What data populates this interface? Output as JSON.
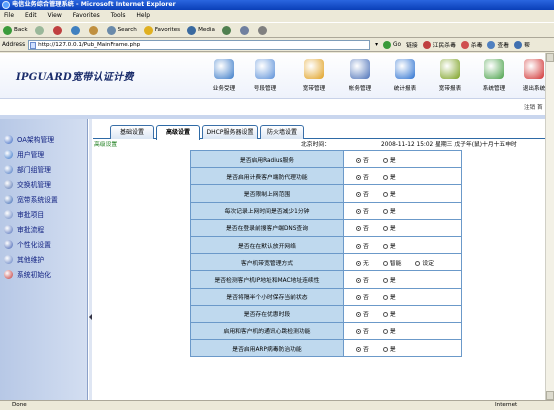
{
  "window": {
    "title": "电信业务综合管理系统 - Microsoft Internet Explorer"
  },
  "menu": [
    "File",
    "Edit",
    "View",
    "Favorites",
    "Tools",
    "Help"
  ],
  "toolbar": {
    "back": "Back",
    "search": "Search",
    "favorites": "Favorites",
    "media": "Media"
  },
  "address": {
    "label": "Address",
    "url": "http://127.0.0.1/Pub_MainFrame.php",
    "go": "Go",
    "links": "链接",
    "extra1": "江民杀毒",
    "extra2": "杀毒",
    "extra3": "查看",
    "extra4": "帮"
  },
  "app": {
    "brand": "IPGUARD宽带认证计费",
    "logout": "注销",
    "logout_extra": "首"
  },
  "nav": [
    {
      "label": "业务受理",
      "color": "#3a7ac8"
    },
    {
      "label": "号段管理",
      "color": "#5a8fd8"
    },
    {
      "label": "宽带管理",
      "color": "#e0a020"
    },
    {
      "label": "帐务管理",
      "color": "#4a70b8"
    },
    {
      "label": "统计报表",
      "color": "#2a70d0"
    },
    {
      "label": "宽带报表",
      "color": "#7aa020"
    },
    {
      "label": "系统管理",
      "color": "#48a048"
    },
    {
      "label": "退出系统",
      "color": "#d03030"
    }
  ],
  "sidebar": {
    "items": [
      {
        "label": "OA架构管理",
        "color": "#3060c0"
      },
      {
        "label": "用户管理",
        "color": "#3070c8"
      },
      {
        "label": "部门组管理",
        "color": "#4070c0"
      },
      {
        "label": "交换机管理",
        "color": "#5070b0"
      },
      {
        "label": "宽带系统设置",
        "color": "#3060b0"
      },
      {
        "label": "审批项目",
        "color": "#6080c0"
      },
      {
        "label": "审批流程",
        "color": "#4a6ab8"
      },
      {
        "label": "个性化设置",
        "color": "#3a5ab0"
      },
      {
        "label": "其他维护",
        "color": "#5a7ac0"
      },
      {
        "label": "系统初始化",
        "color": "#c03030"
      }
    ]
  },
  "tabs": [
    {
      "label": "基础设置"
    },
    {
      "label": "高级设置",
      "active": true
    },
    {
      "label": "DHCP服务器设置"
    },
    {
      "label": "防火墙设置"
    }
  ],
  "panel": {
    "section": "高级设置",
    "time_label": "北京时间：",
    "time_value": "2008-11-12 15:02 星期三 戊子年(鼠)十月十五申时"
  },
  "settings": [
    {
      "question": "是否启用Radius服务",
      "options": [
        "否",
        "是"
      ],
      "selected": 0
    },
    {
      "question": "是否启用计费客户端防代理功能",
      "options": [
        "否",
        "是"
      ],
      "selected": 0
    },
    {
      "question": "是否限制上网范围",
      "options": [
        "否",
        "是"
      ],
      "selected": 0
    },
    {
      "question": "每次记录上网时间是否减少1分钟",
      "options": [
        "否",
        "是"
      ],
      "selected": 0
    },
    {
      "question": "是否在登录前搜客户端DNS查询",
      "options": [
        "否",
        "是"
      ],
      "selected": 0
    },
    {
      "question": "是否在在默认放开网络",
      "options": [
        "否",
        "是"
      ],
      "selected": 0
    },
    {
      "question": "客户机带宽管理方式",
      "options": [
        "无",
        "智能",
        "设定"
      ],
      "selected": 0
    },
    {
      "question": "是否检测客户机IP地址和MAC地址连续性",
      "options": [
        "否",
        "是"
      ],
      "selected": 0
    },
    {
      "question": "是否将隔半个小时保存当前状态",
      "options": [
        "否",
        "是"
      ],
      "selected": 0
    },
    {
      "question": "是否存在优惠时段",
      "options": [
        "否",
        "是"
      ],
      "selected": 0
    },
    {
      "question": "启用和客户机的通讯心跳检测功能",
      "options": [
        "否",
        "是"
      ],
      "selected": 0
    },
    {
      "question": "是否启用ARP病毒防治功能",
      "options": [
        "否",
        "是"
      ],
      "selected": 0
    }
  ],
  "status": {
    "left": "Done",
    "right": "Internet"
  }
}
